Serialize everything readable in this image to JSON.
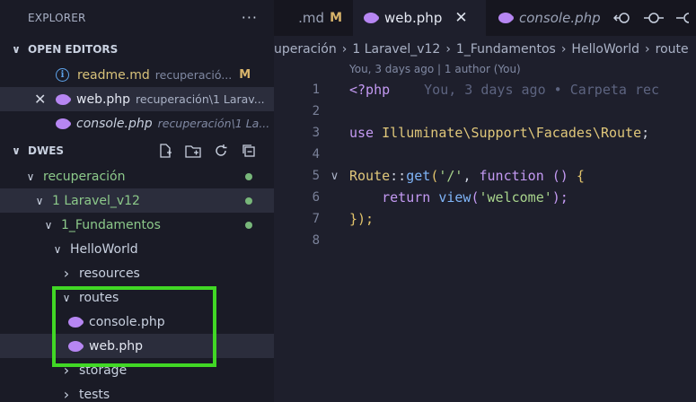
{
  "explorer": {
    "title": "EXPLORER",
    "more": "···",
    "open_editors_label": "OPEN EDITORS",
    "open_editors": [
      {
        "name": "readme.md",
        "path": "recuperació...",
        "badge": "M"
      },
      {
        "name": "web.php",
        "path": "recuperación\\1 Larav...",
        "close": "✕"
      },
      {
        "name": "console.php",
        "path": "recuperación\\1 La..."
      }
    ],
    "workspace_label": "DWES",
    "tree": [
      {
        "label": "recuperación"
      },
      {
        "label": "1 Laravel_v12"
      },
      {
        "label": "1_Fundamentos"
      },
      {
        "label": "HelloWorld"
      },
      {
        "label": "resources"
      },
      {
        "label": "routes"
      },
      {
        "label": "console.php"
      },
      {
        "label": "web.php"
      },
      {
        "label": "storage"
      },
      {
        "label": "tests"
      }
    ]
  },
  "tabs": [
    {
      "label": ".md",
      "badge": "M"
    },
    {
      "label": "web.php",
      "close": "✕"
    },
    {
      "label": "console.php"
    }
  ],
  "breadcrumb": [
    "uperación",
    "1 Laravel_v12",
    "1_Fundamentos",
    "HelloWorld",
    "route"
  ],
  "codelens": "You, 3 days ago | 1 author (You)",
  "code": {
    "line_numbers": [
      "1",
      "2",
      "3",
      "4",
      "5",
      "6",
      "7",
      "8"
    ],
    "line1_open": "<?php",
    "line1_blame": "You, 3 days ago • Carpeta rec",
    "line3_use": "use",
    "line3_ns": "Illuminate\\Support\\Facades\\Route",
    "line3_semi": ";",
    "line5_class": "Route",
    "line5_op": "::",
    "line5_get": "get",
    "line5_open": "(",
    "line5_str": "'/'",
    "line5_comma": ", ",
    "line5_function": "function",
    "line5_sp": " ",
    "line5_parens": "()",
    "line5_brace": " {",
    "line6_return": "return",
    "line6_view": "view",
    "line6_open": "(",
    "line6_str": "'welcome'",
    "line6_close": ");",
    "line7": "});"
  },
  "colors": {
    "highlight": "#41d825",
    "php_icon": "#b686f2",
    "modified": "#d8b46a"
  }
}
